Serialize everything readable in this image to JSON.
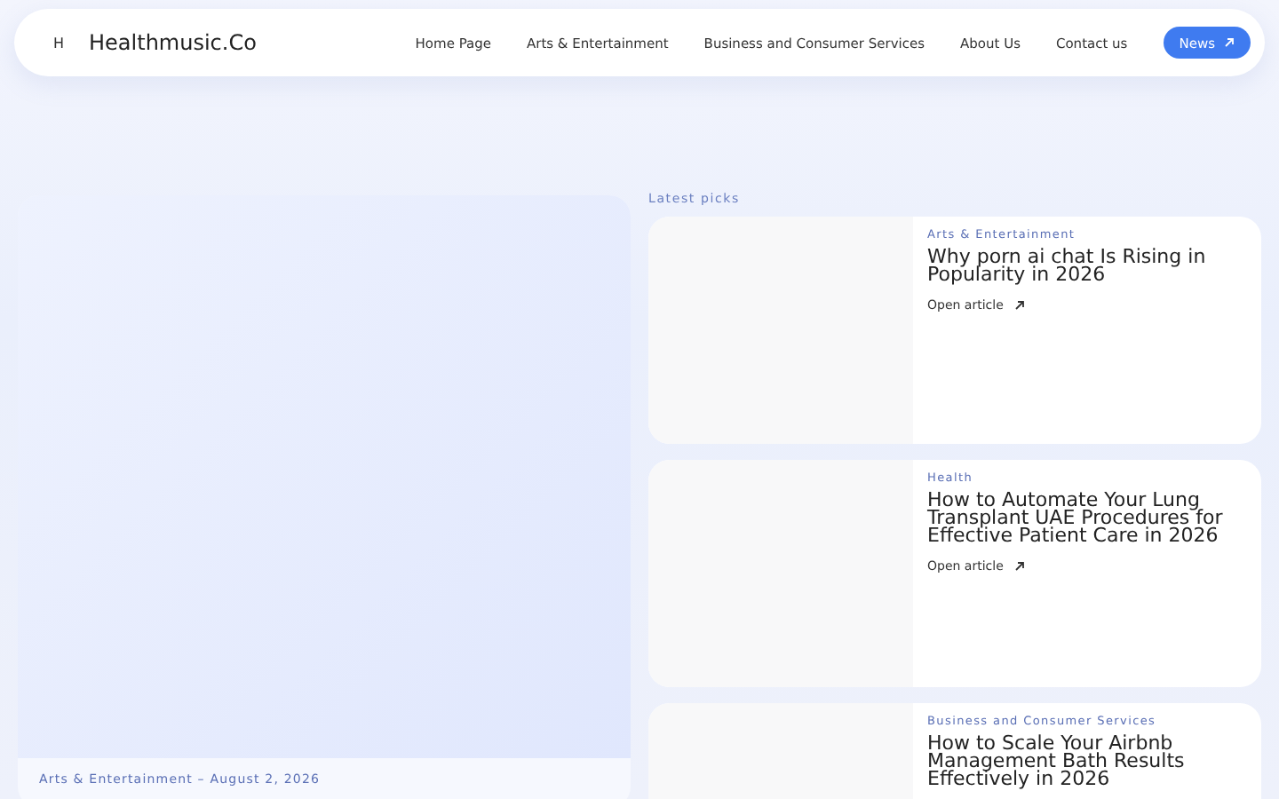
{
  "header": {
    "logo_mark": "H",
    "site_name": "Healthmusic.Co",
    "nav": [
      {
        "label": "Home Page",
        "kind": "link"
      },
      {
        "label": "Arts & Entertainment",
        "kind": "link"
      },
      {
        "label": "Business and Consumer Services",
        "kind": "link"
      },
      {
        "label": "About Us",
        "kind": "link"
      },
      {
        "label": "Contact us",
        "kind": "link"
      },
      {
        "label": "News",
        "kind": "button"
      }
    ]
  },
  "featured": {
    "meta": "Arts & Entertainment  –  August 2, 2026"
  },
  "latest": {
    "heading": "Latest picks",
    "articles": [
      {
        "category": "Arts & Entertainment",
        "title": "Why porn ai chat Is Rising in Popularity in 2026",
        "link": "Open article"
      },
      {
        "category": "Health",
        "title": "How to Automate Your Lung Transplant UAE Procedures for Effective Patient Care in 2026",
        "link": "Open article"
      },
      {
        "category": "Business and Consumer Services",
        "title": "How to Scale Your Airbnb Management Bath Results Effectively in 2026"
      }
    ]
  }
}
